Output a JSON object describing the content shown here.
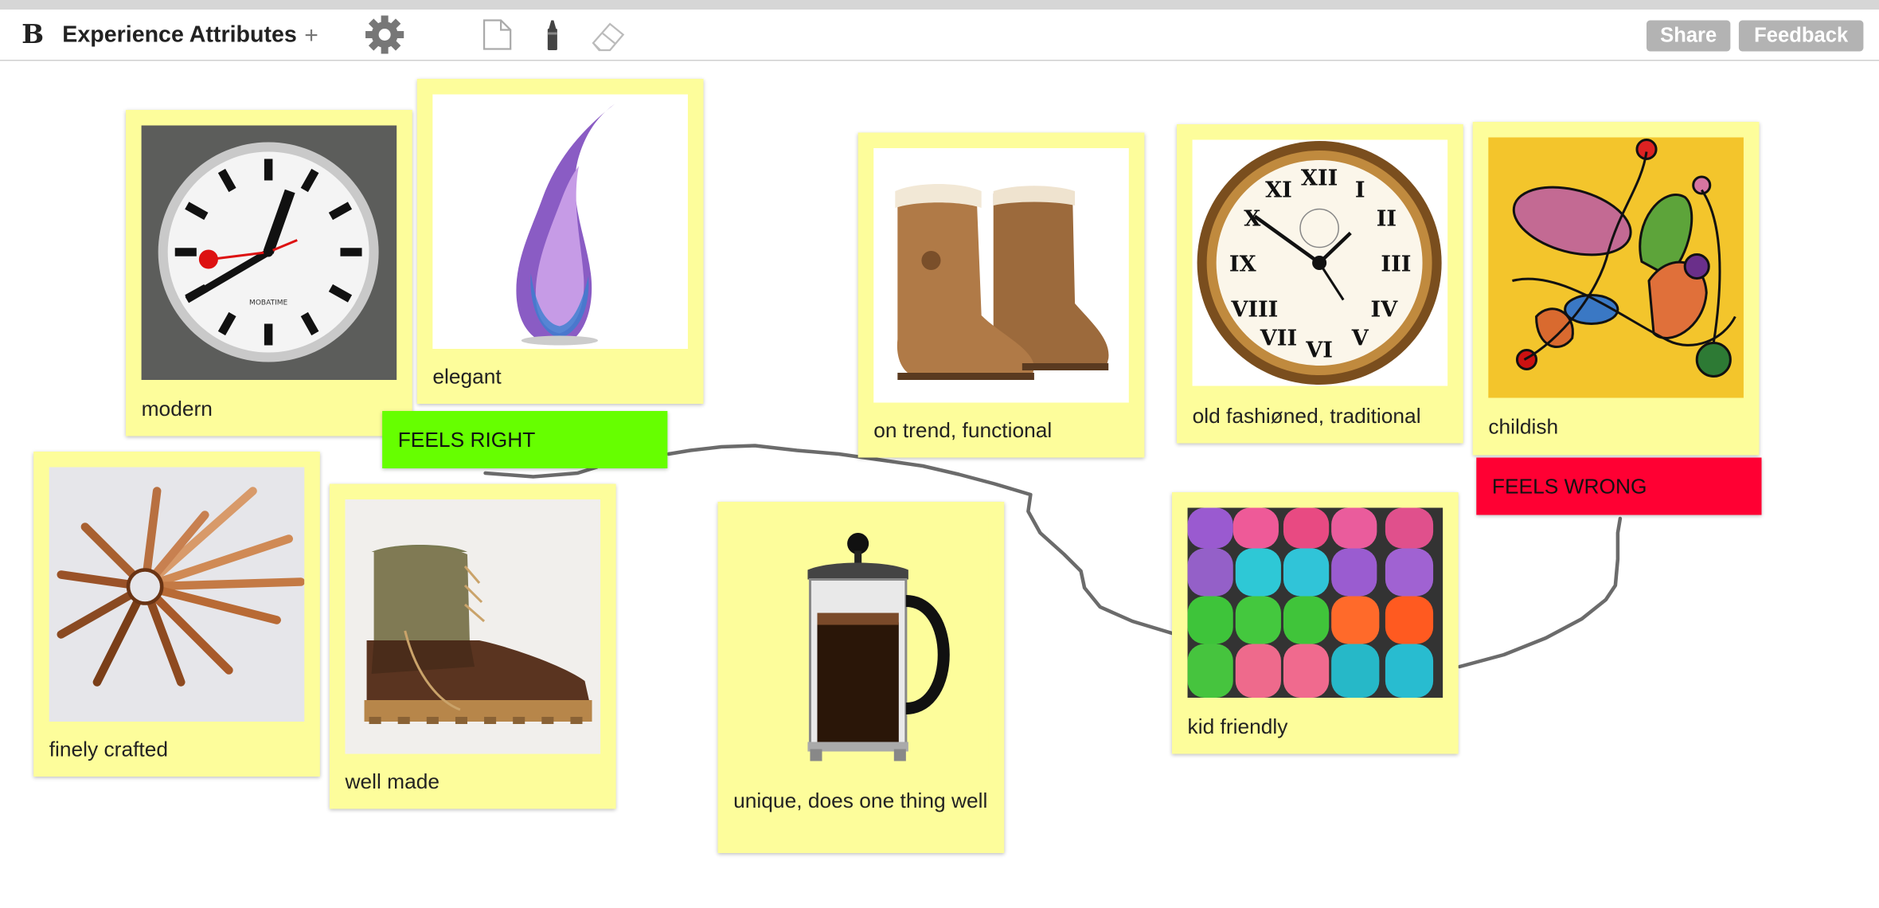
{
  "app": {
    "logo": "B",
    "board_title": "Experience Attributes",
    "add_label": "+"
  },
  "toolbar": {
    "tools": [
      {
        "name": "settings",
        "icon": "gear-icon"
      },
      {
        "name": "new-note",
        "icon": "page-icon"
      },
      {
        "name": "marker",
        "icon": "marker-icon"
      },
      {
        "name": "eraser",
        "icon": "eraser-icon"
      }
    ],
    "share_label": "Share",
    "feedback_label": "Feedback"
  },
  "cards": [
    {
      "label": "modern",
      "image": "station-wall-clock"
    },
    {
      "label": "elegant",
      "image": "purple-glass-vase"
    },
    {
      "label": "on trend, functional",
      "image": "sheepskin-boots"
    },
    {
      "label": "old fashiøned, traditional",
      "image": "antique-clock-face"
    },
    {
      "label": "childish",
      "image": "child-scribble-drawing"
    },
    {
      "label": "finely crafted",
      "image": "wooden-spiral-sculpture"
    },
    {
      "label": "well made",
      "image": "leather-work-boot"
    },
    {
      "label": "unique, does one thing well",
      "image": "french-press"
    },
    {
      "label": "kid friendly",
      "image": "colorful-clogs"
    }
  ],
  "tags": {
    "feels_right": {
      "label": "FEELS RIGHT",
      "color": "#66ff00"
    },
    "feels_wrong": {
      "label": "FEELS WRONG",
      "color": "#ff0033"
    }
  },
  "colors": {
    "note": "#fdfd9b",
    "button": "#b3b3b3",
    "connector": "#6b6b6b"
  }
}
